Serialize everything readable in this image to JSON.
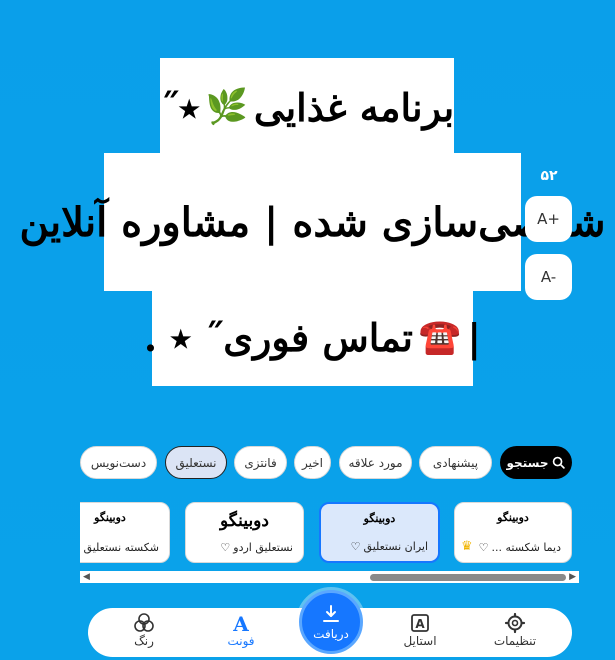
{
  "preview": {
    "line1_text": "برنامه غذایی",
    "line1_emoji": "🌿",
    "line1_tail": "٭˝",
    "line2_text": "شخصی‌سازی شده | مشاوره آنلاین",
    "line3_head": "|",
    "line3_emoji": "☎️",
    "line3_text": "تماس فوری˝ ٭ .",
    "font_size": "۵۲"
  },
  "size_controls": {
    "increase": "A+",
    "decrease": "A-"
  },
  "categories": {
    "search": "جستجو",
    "items": [
      "پیشنهادی",
      "مورد علاقه",
      "اخیر",
      "فانتزی",
      "نستعلیق",
      "دست‌نویس"
    ],
    "selected": "نستعلیق"
  },
  "fonts": [
    {
      "sample": "دوبینگو",
      "name": "دیما شکسته ...",
      "premium": true
    },
    {
      "sample": "دوبینگو",
      "name": "ایران نستعلیق",
      "premium": false
    },
    {
      "sample": "دوبینگو",
      "name": "نستعلیق اردو",
      "premium": false
    },
    {
      "sample": "دوبینگو",
      "name": "شکسته نستعلیق",
      "premium": false
    }
  ],
  "nav": {
    "settings": "تنظیمات",
    "style": "استایل",
    "download": "دریافت",
    "font": "فونت",
    "color": "رنگ",
    "active": "font"
  },
  "colors": {
    "background": "#0aa2ea",
    "accent": "#1677ff",
    "premium": "#f0b400"
  },
  "icons": {
    "settings": "gear-icon",
    "style": "style-a-icon",
    "download": "download-icon",
    "font": "font-a-icon",
    "color": "color-circles-icon",
    "search": "search-icon",
    "heart": "heart-icon",
    "crown": "crown-icon"
  }
}
